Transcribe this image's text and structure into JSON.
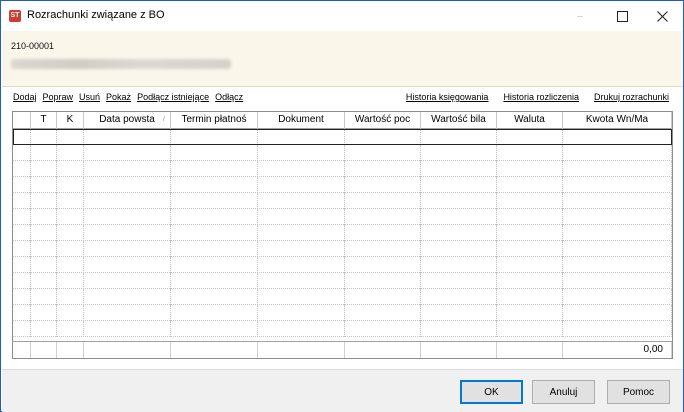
{
  "window": {
    "title": "Rozrachunki związane z BO",
    "icon_label": "ST",
    "controls": {
      "minimize": "–",
      "maximize": "□",
      "close": "✕"
    }
  },
  "header": {
    "account_code": "210-00001"
  },
  "toolbar_left": [
    {
      "id": "dodaj",
      "label": "Dodaj"
    },
    {
      "id": "popraw",
      "label": "Popraw"
    },
    {
      "id": "usun",
      "label": "Usuń"
    },
    {
      "id": "pokaz",
      "label": "Pokaż"
    },
    {
      "id": "podlacz",
      "label": "Podłącz istniejące"
    },
    {
      "id": "odlacz",
      "label": "Odłącz"
    }
  ],
  "toolbar_right": [
    {
      "id": "historia-ksiegowania",
      "label": "Historia księgowania"
    },
    {
      "id": "historia-rozliczenia",
      "label": "Historia rozliczenia"
    },
    {
      "id": "drukuj",
      "label": "Drukuj rozrachunki"
    }
  ],
  "grid": {
    "columns": [
      {
        "id": "sel",
        "label": ""
      },
      {
        "id": "t",
        "label": "T"
      },
      {
        "id": "k",
        "label": "K"
      },
      {
        "id": "data",
        "label": "Data powsta",
        "sort_icon": "/"
      },
      {
        "id": "termin",
        "label": "Termin płatnoś"
      },
      {
        "id": "dokument",
        "label": "Dokument"
      },
      {
        "id": "wartosc-poc",
        "label": "Wartość poc"
      },
      {
        "id": "wartosc-bil",
        "label": "Wartość bila"
      },
      {
        "id": "waluta",
        "label": "Waluta"
      },
      {
        "id": "kwota",
        "label": "Kwota Wn/Ma"
      }
    ],
    "empty_rows": 13,
    "footer_total": "0,00"
  },
  "buttons": {
    "ok": "OK",
    "cancel": "Anuluj",
    "help": "Pomoc"
  }
}
